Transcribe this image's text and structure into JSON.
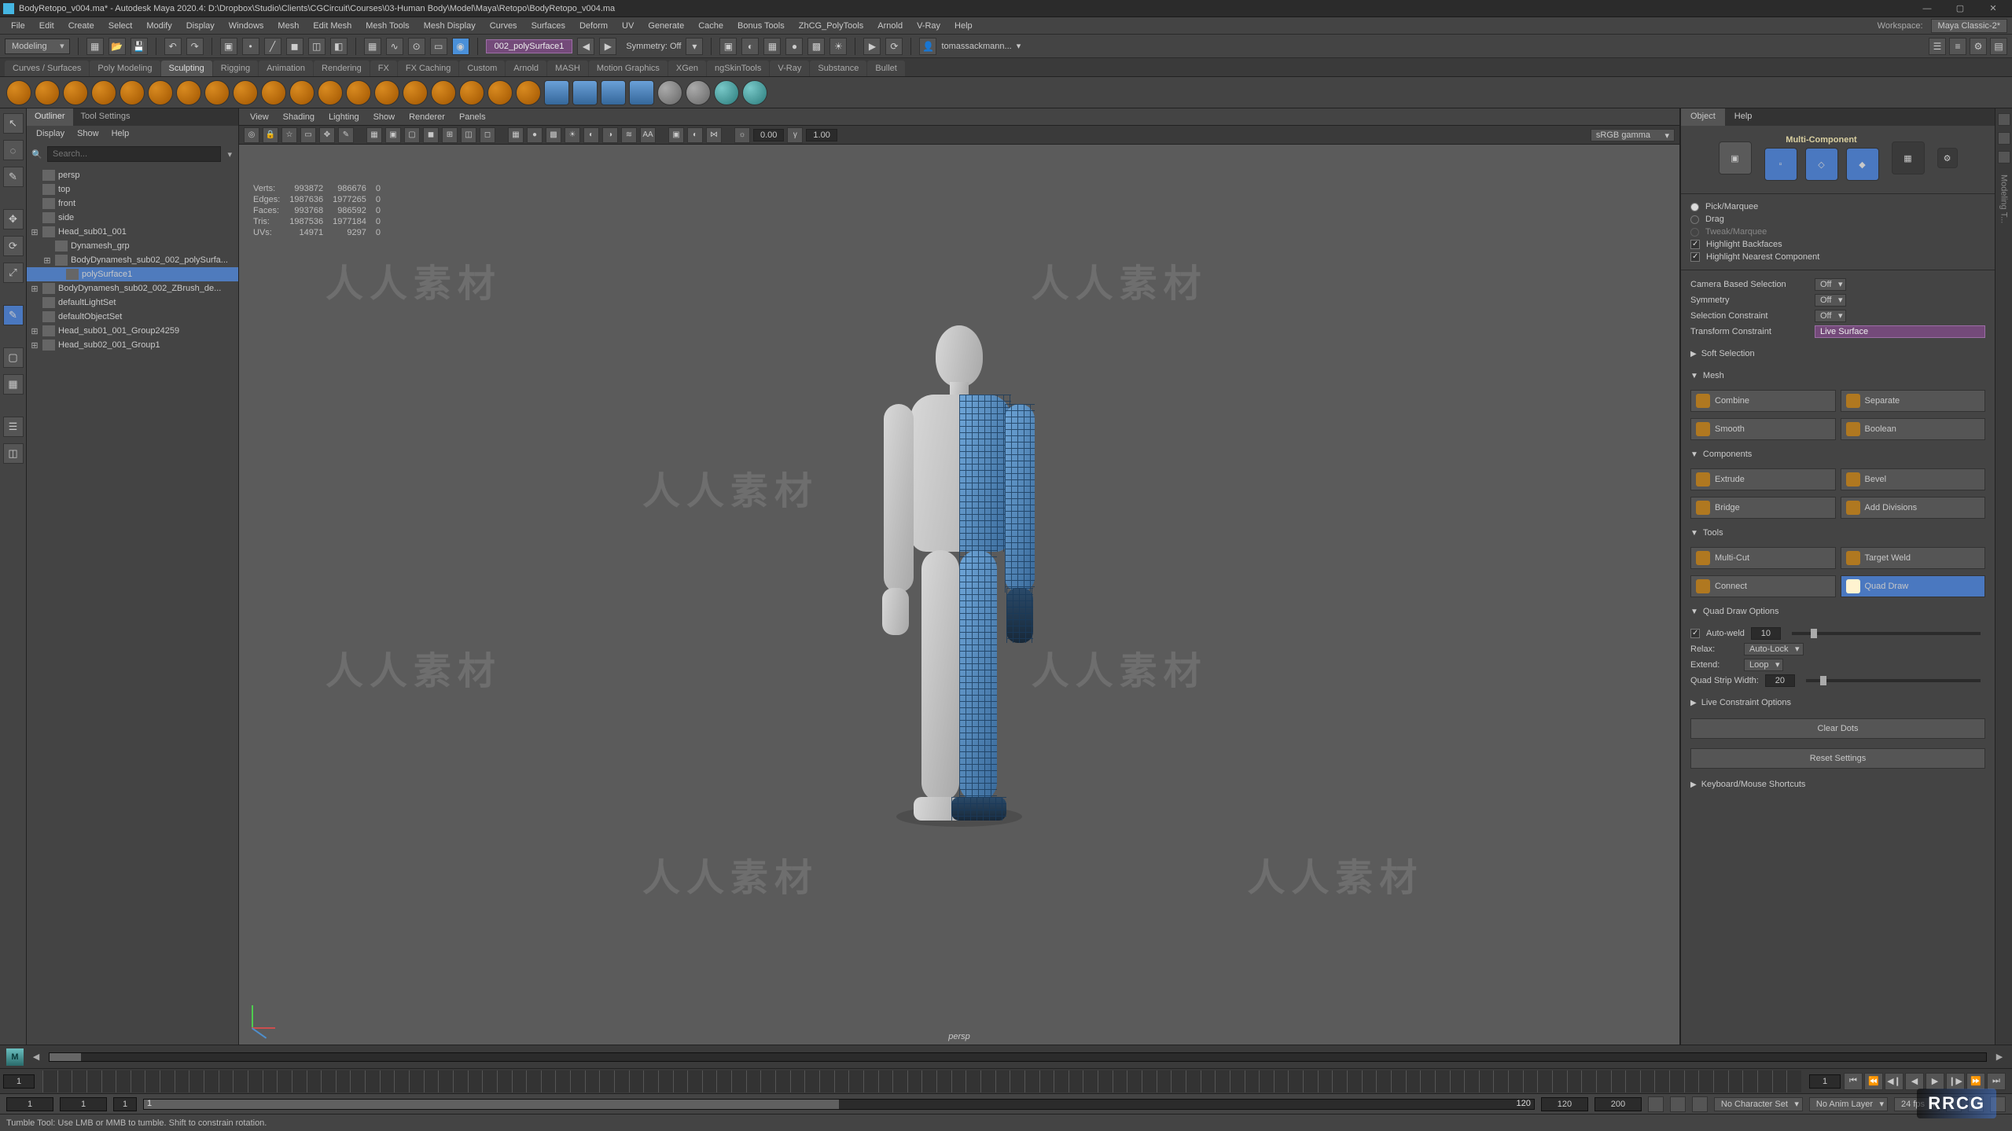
{
  "title": "BodyRetopo_v004.ma* - Autodesk Maya 2020.4: D:\\Dropbox\\Studio\\Clients\\CGCircuit\\Courses\\03-Human Body\\Model\\Maya\\Retopo\\BodyRetopo_v004.ma",
  "workspace_label": "Workspace:",
  "workspace_value": "Maya Classic-2*",
  "menus": [
    "File",
    "Edit",
    "Create",
    "Select",
    "Modify",
    "Display",
    "Windows",
    "Mesh",
    "Edit Mesh",
    "Mesh Tools",
    "Mesh Display",
    "Curves",
    "Surfaces",
    "Deform",
    "UV",
    "Generate",
    "Cache",
    "Bonus Tools",
    "ZhCG_PolyTools",
    "Arnold",
    "V-Ray",
    "Help"
  ],
  "module_dropdown": "Modeling",
  "live_object": "002_polySurface1",
  "symmetry_label": "Symmetry:",
  "symmetry_value": "Off",
  "account": "tomassackmann...",
  "shelf_tabs": [
    "Curves / Surfaces",
    "Poly Modeling",
    "Sculpting",
    "Rigging",
    "Animation",
    "Rendering",
    "FX",
    "FX Caching",
    "Custom",
    "Arnold",
    "MASH",
    "Motion Graphics",
    "XGen",
    "ngSkinTools",
    "V-Ray",
    "Substance",
    "Bullet"
  ],
  "shelf_active": "Sculpting",
  "outliner_tabs": [
    "Outliner",
    "Tool Settings"
  ],
  "outliner_menus": [
    "Display",
    "Show",
    "Help"
  ],
  "search_placeholder": "Search...",
  "outline_items": [
    {
      "name": "persp",
      "dim": true
    },
    {
      "name": "top",
      "dim": true
    },
    {
      "name": "front",
      "dim": true
    },
    {
      "name": "side",
      "dim": true
    },
    {
      "name": "Head_sub01_001",
      "expand": true
    },
    {
      "name": "Dynamesh_grp",
      "dim": true,
      "indent": 1
    },
    {
      "name": "BodyDynamesh_sub02_002_polySurfa...",
      "indent": 1,
      "expand": true
    },
    {
      "name": "polySurface1",
      "indent": 2,
      "sel": true
    },
    {
      "name": "BodyDynamesh_sub02_002_ZBrush_de...",
      "expand": true
    },
    {
      "name": "defaultLightSet"
    },
    {
      "name": "defaultObjectSet"
    },
    {
      "name": "Head_sub01_001_Group24259",
      "expand": true
    },
    {
      "name": "Head_sub02_001_Group1",
      "expand": true
    }
  ],
  "vp_menus": [
    "View",
    "Shading",
    "Lighting",
    "Show",
    "Renderer",
    "Panels"
  ],
  "vp_exposure": "0.00",
  "vp_gamma": "1.00",
  "vp_colorspace": "sRGB gamma",
  "hud": {
    "rows": [
      [
        "Verts:",
        "993872",
        "986676",
        "0"
      ],
      [
        "Edges:",
        "1987636",
        "1977265",
        "0"
      ],
      [
        "Faces:",
        "993768",
        "986592",
        "0"
      ],
      [
        "Tris:",
        "1987536",
        "1977184",
        "0"
      ],
      [
        "UVs:",
        "14971",
        "9297",
        "0"
      ]
    ]
  },
  "cam_label": "persp",
  "watermark": "人人素材",
  "rp_tabs": [
    "Object",
    "Help"
  ],
  "multicomponent_label": "Multi-Component",
  "selmode": {
    "pick": "Pick/Marquee",
    "drag": "Drag",
    "tweak": "Tweak/Marquee",
    "hback": "Highlight Backfaces",
    "hnear": "Highlight Nearest Component"
  },
  "camera_sel_label": "Camera Based Selection",
  "camera_sel_val": "Off",
  "symm_label": "Symmetry",
  "symm_val": "Off",
  "selcon_label": "Selection Constraint",
  "selcon_val": "Off",
  "trcon_label": "Transform Constraint",
  "trcon_val": "Live Surface",
  "softsel": "Soft Selection",
  "sect_mesh": "Mesh",
  "mesh_btns": [
    "Combine",
    "Separate",
    "Smooth",
    "Boolean"
  ],
  "sect_components": "Components",
  "comp_btns": [
    "Extrude",
    "Bevel",
    "Bridge",
    "Add Divisions"
  ],
  "sect_tools": "Tools",
  "tool_btns": [
    "Multi-Cut",
    "Target Weld",
    "Connect",
    "Quad Draw"
  ],
  "tool_selected": "Quad Draw",
  "sect_qd": "Quad Draw Options",
  "autoweld_label": "Auto-weld",
  "autoweld_val": "10",
  "relax_label": "Relax:",
  "relax_val": "Auto-Lock",
  "extend_label": "Extend:",
  "extend_val": "Loop",
  "qstrip_label": "Quad Strip Width:",
  "qstrip_val": "20",
  "livecon": "Live Constraint Options",
  "clear_dots": "Clear Dots",
  "reset_settings": "Reset Settings",
  "keyshort": "Keyboard/Mouse Shortcuts",
  "timeline_cur": "1",
  "range_start_out": "1",
  "range_start_in": "1",
  "range_cmd_prefix": "1",
  "range_fill_start": "1",
  "range_fill_end": "120",
  "range_end_in": "120",
  "range_end_out": "200",
  "no_char": "No Character Set",
  "no_anim": "No Anim Layer",
  "fps": "24 fps",
  "status_msg": "Tumble Tool: Use LMB or MMB to tumble. Shift to constrain rotation.",
  "badge": "RRCG"
}
